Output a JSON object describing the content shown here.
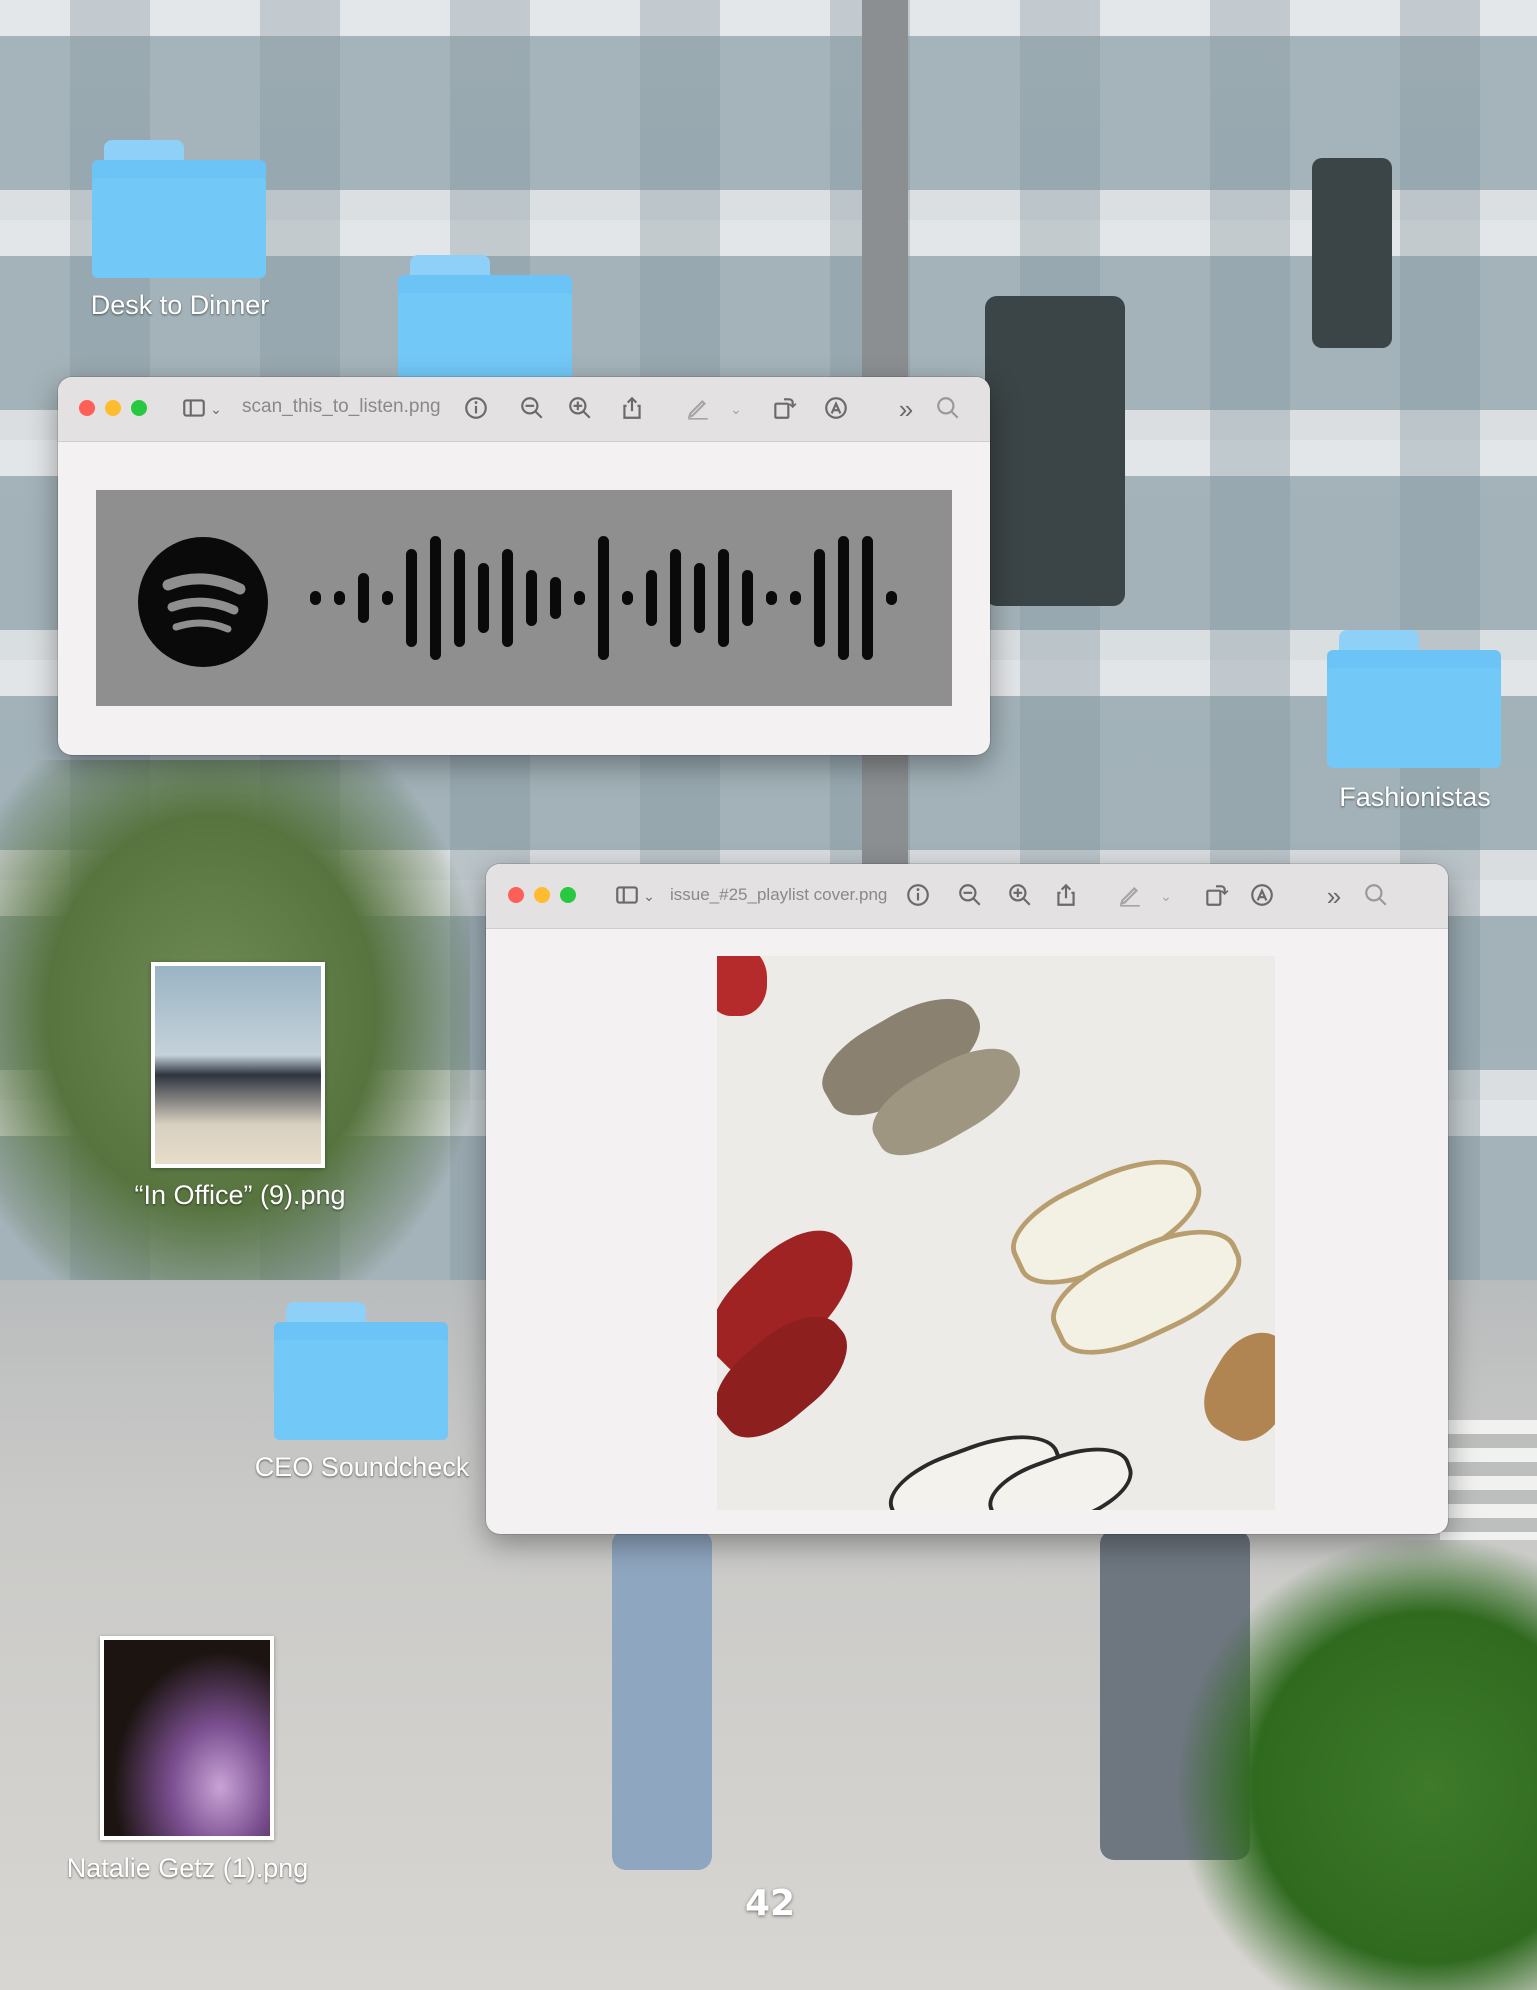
{
  "desktop": {
    "folders": [
      {
        "label": "Desk to Dinner"
      },
      {
        "label": ""
      },
      {
        "label": "Fashionistas"
      },
      {
        "label": "CEO Soundcheck"
      }
    ],
    "files": [
      {
        "label": "“In Office” (9).png"
      },
      {
        "label": "Natalie Getz (1).png"
      }
    ],
    "page_number": "42"
  },
  "windows": [
    {
      "title": "scan_this_to_listen.png",
      "icons": [
        "sidebar-toggle-icon",
        "chevron-down-icon",
        "info-icon",
        "zoom-out-icon",
        "zoom-in-icon",
        "share-icon",
        "markup-pen-icon",
        "chevron-down-icon",
        "rotate-icon",
        "annotate-icon",
        "more-chevrons-icon",
        "search-icon"
      ],
      "content": "spotify-code"
    },
    {
      "title": "issue_#25_playlist cover.png",
      "icons": [
        "sidebar-toggle-icon",
        "chevron-down-icon",
        "info-icon",
        "zoom-out-icon",
        "zoom-in-icon",
        "share-icon",
        "markup-pen-icon",
        "chevron-down-icon",
        "rotate-icon",
        "annotate-icon",
        "more-chevrons-icon",
        "search-icon"
      ],
      "content": "shoes-photo"
    }
  ],
  "colors": {
    "folder": "#6cc4f6",
    "close": "#fe5f57",
    "minimize": "#febc2e",
    "zoom": "#28c840",
    "spotify_card": "#8f8f8f"
  }
}
